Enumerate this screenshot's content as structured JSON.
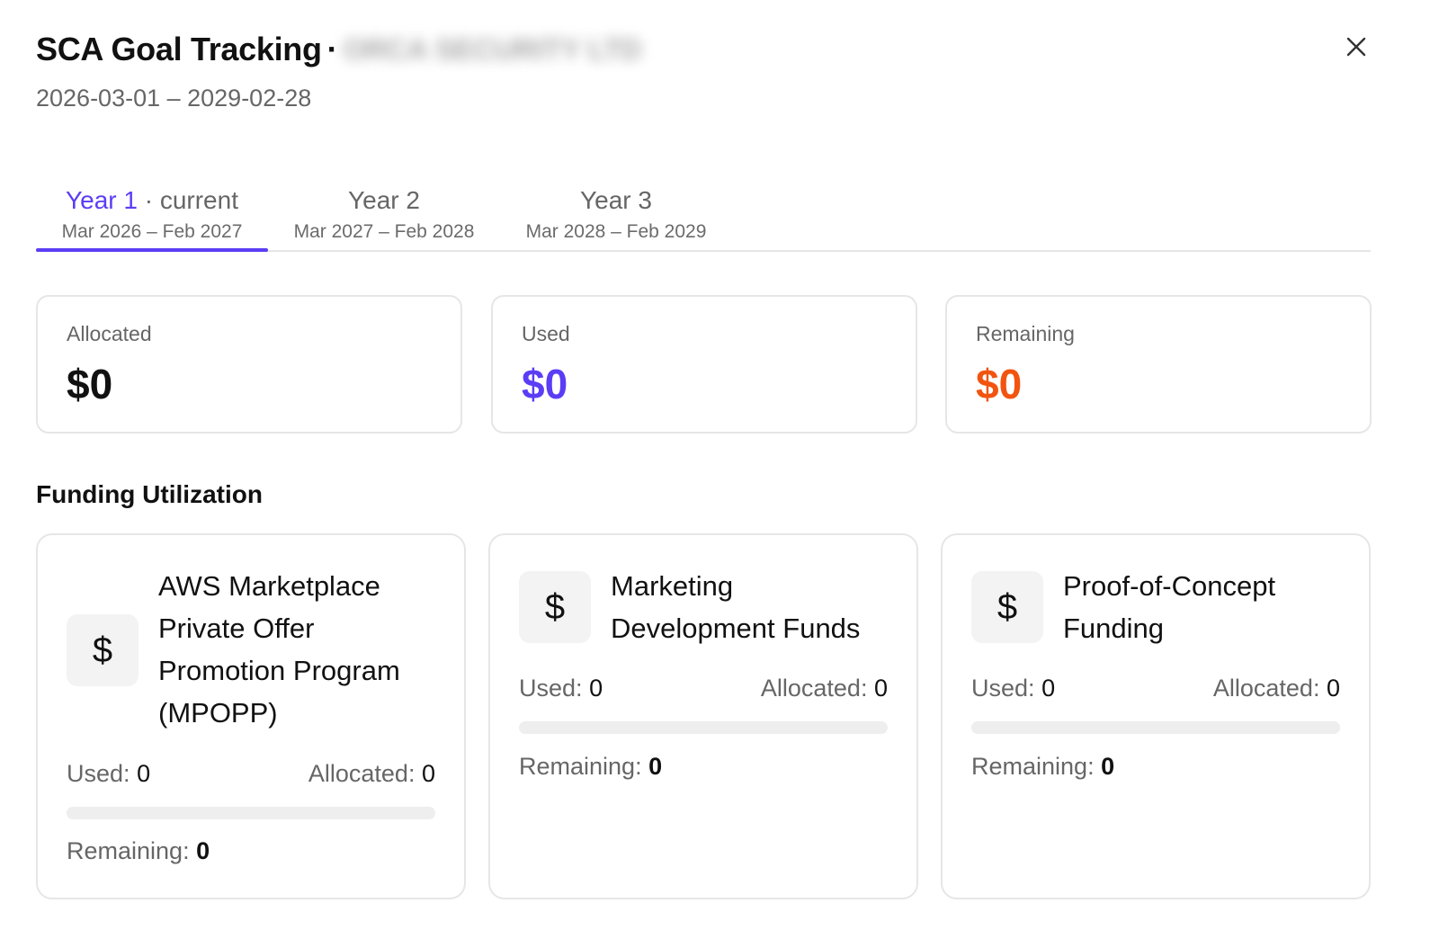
{
  "header": {
    "title": "SCA Goal Tracking",
    "separator": "·",
    "company_redacted": "ORCA SECURITY LTD",
    "date_range": "2026-03-01 – 2029-02-28"
  },
  "tabs": [
    {
      "year": "Year 1",
      "suffix": "· current",
      "range": "Mar 2026 – Feb 2027",
      "active": true
    },
    {
      "year": "Year 2",
      "suffix": "",
      "range": "Mar 2027 – Feb 2028",
      "active": false
    },
    {
      "year": "Year 3",
      "suffix": "",
      "range": "Mar 2028 – Feb 2029",
      "active": false
    }
  ],
  "summary": {
    "allocated": {
      "label": "Allocated",
      "value": "$0",
      "color": "#111111"
    },
    "used": {
      "label": "Used",
      "value": "$0",
      "color": "#5b3df5"
    },
    "remaining": {
      "label": "Remaining",
      "value": "$0",
      "color": "#f25410"
    }
  },
  "section_title": "Funding Utilization",
  "funds": [
    {
      "icon": "$",
      "name": "AWS Marketplace Private Offer Promotion Program (MPOPP)",
      "used_label": "Used:",
      "used": "0",
      "allocated_label": "Allocated:",
      "allocated": "0",
      "remaining_label": "Remaining:",
      "remaining": "0",
      "progress": 0
    },
    {
      "icon": "$",
      "name": "Marketing Development Funds",
      "used_label": "Used:",
      "used": "0",
      "allocated_label": "Allocated:",
      "allocated": "0",
      "remaining_label": "Remaining:",
      "remaining": "0",
      "progress": 0
    },
    {
      "icon": "$",
      "name": "Proof-of-Concept Funding",
      "used_label": "Used:",
      "used": "0",
      "allocated_label": "Allocated:",
      "allocated": "0",
      "remaining_label": "Remaining:",
      "remaining": "0",
      "progress": 0
    }
  ],
  "close_icon": "close-icon"
}
